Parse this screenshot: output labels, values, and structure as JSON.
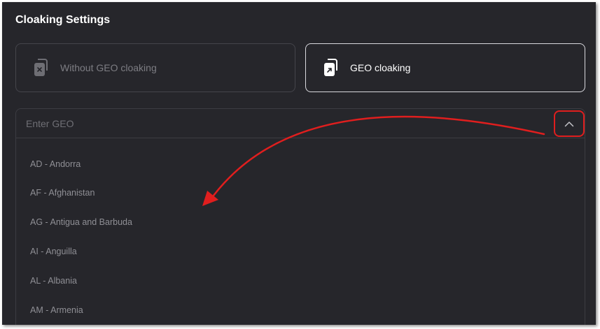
{
  "section": {
    "title": "Cloaking Settings"
  },
  "options": [
    {
      "label": "Without GEO cloaking",
      "icon": "file-x-icon",
      "selected": false
    },
    {
      "label": "GEO cloaking",
      "icon": "file-arrow-icon",
      "selected": true
    }
  ],
  "geo": {
    "placeholder": "Enter GEO",
    "value": "",
    "toggle_icon": "chevron-up-icon",
    "items": [
      "AD - Andorra",
      "AF - Afghanistan",
      "AG - Antigua and Barbuda",
      "AI - Anguilla",
      "AL - Albania",
      "AM - Armenia"
    ]
  },
  "colors": {
    "background": "#26262b",
    "annotation": "#e01e1e",
    "selected_border": "#d9d9de"
  }
}
